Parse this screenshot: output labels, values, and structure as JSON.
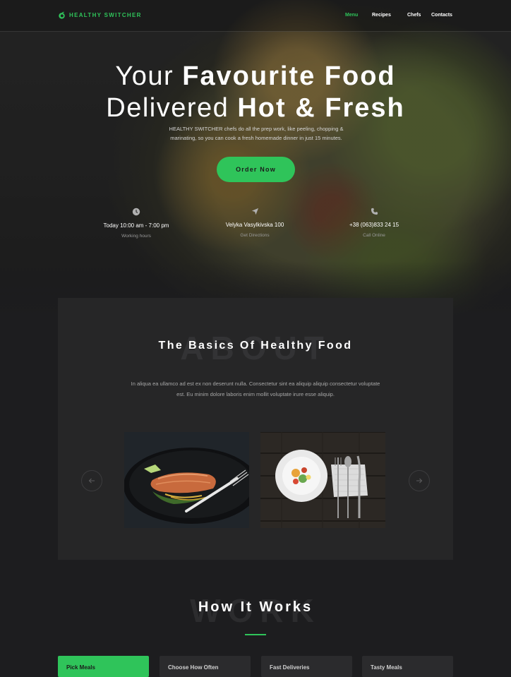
{
  "brand": {
    "name": "HEALTHY SWITCHER",
    "accent_color": "#2fc45a",
    "logo_icon": "apple-icon"
  },
  "nav": {
    "items": [
      {
        "label": "Menu",
        "active": true
      },
      {
        "label": "Recipes",
        "active": false
      },
      {
        "label": "Chefs",
        "active": false
      },
      {
        "label": "Contacts",
        "active": false
      }
    ]
  },
  "hero": {
    "line1_light": "Your ",
    "line1_bold": "Favourite Food",
    "line2_light": "Delivered ",
    "line2_bold": "Hot & Fresh",
    "subtitle": "HEALTHY SWITCHER chefs do all the prep work, like peeling, chopping & marinating, so you can cook a fresh homemade dinner in just 15 minutes.",
    "cta_label": "Order Now"
  },
  "info": [
    {
      "icon": "clock-icon",
      "main": "Today 10:00 am - 7:00 pm",
      "sub": "Working hours"
    },
    {
      "icon": "navigation-arrow-icon",
      "main": "Velyka Vasylkivska 100",
      "sub": "Get Directions"
    },
    {
      "icon": "phone-icon",
      "main": "+38 (063)833 24 15",
      "sub": "Call Online"
    }
  ],
  "about": {
    "watermark": "ABOUT",
    "title": "The Basics Of Healthy Food",
    "text": "In aliqua ea ullamco ad est ex non deserunt nulla. Consectetur sint ea aliquip aliquip consectetur voluptate est. Eu minim dolore laboris enim mollit voluptate irure esse aliquip.",
    "slides": [
      "salmon-dish-photo",
      "plated-salad-photo"
    ]
  },
  "work": {
    "watermark": "WORK",
    "title": "How It Works",
    "steps": [
      {
        "label": "Pick Meals",
        "active": true
      },
      {
        "label": "Choose How Often",
        "active": false
      },
      {
        "label": "Fast Deliveries",
        "active": false
      },
      {
        "label": "Tasty Meals",
        "active": false
      }
    ]
  }
}
